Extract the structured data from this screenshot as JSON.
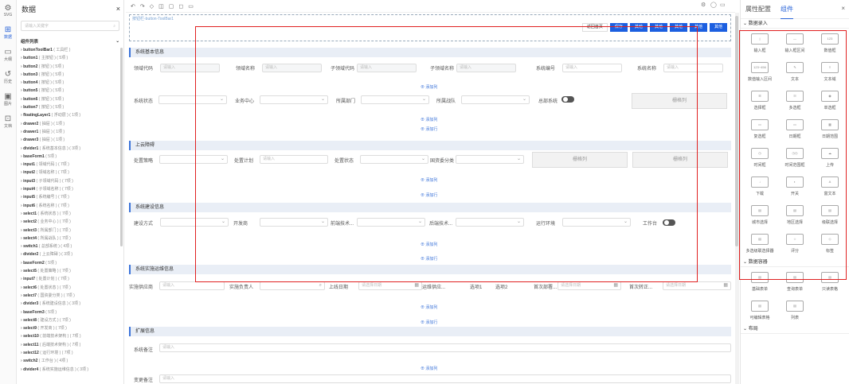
{
  "rail": [
    {
      "icon": "⚙",
      "label": "SVG"
    },
    {
      "icon": "⊞",
      "label": "数据"
    },
    {
      "icon": "▭",
      "label": "大纲"
    },
    {
      "icon": "↺",
      "label": "历史"
    },
    {
      "icon": "▣",
      "label": "图片"
    },
    {
      "icon": "⊡",
      "label": "文档"
    }
  ],
  "datapanel": {
    "title": "数据",
    "close": "×",
    "search_placeholder": "请输入关键字",
    "tree_title": "组件列表",
    "items": [
      {
        "n": "buttonToolBar1",
        "d": "( 工具栏 )"
      },
      {
        "n": "button1",
        "d": "( 主按钮 ) ( 5项 )"
      },
      {
        "n": "button2",
        "d": "( 按钮 ) ( 5项 )"
      },
      {
        "n": "button3",
        "d": "( 按钮 ) ( 5项 )"
      },
      {
        "n": "button4",
        "d": "( 按钮 ) ( 5项 )"
      },
      {
        "n": "button5",
        "d": "( 按钮 ) ( 5项 )"
      },
      {
        "n": "button6",
        "d": "( 按钮 ) ( 5项 )"
      },
      {
        "n": "button7",
        "d": "( 按钮 ) ( 5项 )"
      },
      {
        "n": "floatingLayer1",
        "d": "( 浮动层 ) ( 1项 )"
      },
      {
        "n": "drawer2",
        "d": "( 抽屉 ) ( 1项 )"
      },
      {
        "n": "drawer1",
        "d": "( 抽屉 ) ( 1项 )"
      },
      {
        "n": "drawer3",
        "d": "( 抽屉 ) ( 1项 )"
      },
      {
        "n": "divider1",
        "d": "( 系统基本信息 ) ( 3项 )"
      },
      {
        "n": "baseForm1",
        "d": "( 5项 )"
      },
      {
        "n": "input1",
        "d": "( 领域代码 ) ( 7项 )"
      },
      {
        "n": "input2",
        "d": "( 领域名称 ) ( 7项 )"
      },
      {
        "n": "input3",
        "d": "( 子领域代码 ) ( 7项 )"
      },
      {
        "n": "input4",
        "d": "( 子领域名称 ) ( 7项 )"
      },
      {
        "n": "input5",
        "d": "( 系统编号 ) ( 7项 )"
      },
      {
        "n": "input6",
        "d": "( 系统名称 ) ( 7项 )"
      },
      {
        "n": "select1",
        "d": "( 系统状态 ) ( 7项 )"
      },
      {
        "n": "select2",
        "d": "( 业务中心 ) ( 7项 )"
      },
      {
        "n": "select3",
        "d": "( 所属部门 ) ( 7项 )"
      },
      {
        "n": "select4",
        "d": "( 所属战队 ) ( 7项 )"
      },
      {
        "n": "switch1",
        "d": "( 总部系统 ) ( 4项 )"
      },
      {
        "n": "divider2",
        "d": "( 上云障碍 ) ( 3项 )"
      },
      {
        "n": "baseForm2",
        "d": "( 5项 )"
      },
      {
        "n": "select5",
        "d": "( 处置策略 ) ( 7项 )"
      },
      {
        "n": "input7",
        "d": "( 处置计划 ) ( 7项 )"
      },
      {
        "n": "select6",
        "d": "( 处置状态 ) ( 7项 )"
      },
      {
        "n": "select7",
        "d": "( 国资委分类 ) ( 7项 )"
      },
      {
        "n": "divider3",
        "d": "( 系统建设信息 ) ( 3项 )"
      },
      {
        "n": "baseForm3",
        "d": "( 5项 )"
      },
      {
        "n": "select8",
        "d": "( 建设方式 ) ( 7项 )"
      },
      {
        "n": "select9",
        "d": "( 开发商 ) ( 7项 )"
      },
      {
        "n": "select10",
        "d": "( 前端技术架构 ) ( 7项 )"
      },
      {
        "n": "select11",
        "d": "( 后端技术架构 ) ( 7项 )"
      },
      {
        "n": "select12",
        "d": "( 运行环境 ) ( 7项 )"
      },
      {
        "n": "switch2",
        "d": "( 工作台 ) ( 4项 )"
      },
      {
        "n": "divider4",
        "d": "( 系统实施运维信息 ) ( 3项 )"
      }
    ]
  },
  "toolbar": {
    "left": [
      "↶",
      "↷",
      "◇",
      "◫",
      "▢",
      "◻",
      "▭"
    ],
    "right": [
      "⚙",
      "◯",
      "▭"
    ]
  },
  "canvas": {
    "tbar_label": "按钮栏-button-ToolBar1",
    "buttons": {
      "default": "返回首页",
      "primary": [
        "保存",
        "其他",
        "其他",
        "其他",
        "其他",
        "其他"
      ]
    },
    "s1": "系统基本信息",
    "s2": "上云障碍",
    "s3": "系统建设信息",
    "s4": "系统实施运维信息",
    "s5": "扩展信息",
    "placeholder": "请输入",
    "placeholder_date": "请选择日期",
    "grid_label": "栅格列",
    "add_col": "添加列",
    "add_row": "添加行",
    "f1": [
      "领域代码",
      "领域名称",
      "子领域代码",
      "子领域名称",
      "系统编号",
      "系统名称"
    ],
    "f2": [
      "系统状态",
      "业务中心",
      "所属部门",
      "所属战队",
      "总部系统"
    ],
    "f3": [
      "处置策略",
      "处置计划",
      "处置状态",
      "国资委分类"
    ],
    "f4": [
      "建设方式",
      "开发商",
      "前端技术...",
      "后端技术...",
      "运行环境",
      "工作台"
    ],
    "f5": [
      "实施供应商",
      "实施负责人",
      "上线日期",
      "运维供应...",
      "选项1",
      "选项2",
      "首次部署...",
      "首次转正..."
    ],
    "f6": [
      "系统备注",
      "变更备注"
    ]
  },
  "props": {
    "tabs": [
      "属性配置",
      "组件"
    ],
    "close": "×",
    "g1": "数据录入",
    "g2": "数据容器",
    "g3": "布局",
    "items": [
      {
        "i": "|",
        "l": "输入框"
      },
      {
        "i": "—",
        "l": "输入框区间"
      },
      {
        "i": "123",
        "l": "数值框"
      },
      {
        "i": "123~456",
        "l": "数值输入区间"
      },
      {
        "i": "✎",
        "l": "文本"
      },
      {
        "i": "≡",
        "l": "文本域"
      },
      {
        "i": "☰",
        "l": "选择框"
      },
      {
        "i": "☷",
        "l": "多选框"
      },
      {
        "i": "◉",
        "l": "单选框"
      },
      {
        "i": "▭",
        "l": "复选框"
      },
      {
        "i": "▭",
        "l": "日期框"
      },
      {
        "i": "▦",
        "l": "日期范围"
      },
      {
        "i": "◷",
        "l": "时间框"
      },
      {
        "i": "◷◷",
        "l": "时间范围框"
      },
      {
        "i": "☁",
        "l": "上传"
      },
      {
        "i": "↓",
        "l": "下载"
      },
      {
        "i": "◐",
        "l": "开关"
      },
      {
        "i": "A",
        "l": "富文本"
      },
      {
        "i": "▤",
        "l": "城市选择"
      },
      {
        "i": "▤",
        "l": "地区选择"
      },
      {
        "i": "▤",
        "l": "级联选择"
      },
      {
        "i": "▤",
        "l": "多选级联选择器"
      },
      {
        "i": "☆",
        "l": "评分"
      },
      {
        "i": "◇",
        "l": "标签"
      }
    ],
    "items2": [
      {
        "i": "▤",
        "l": "基础表单"
      },
      {
        "i": "▤",
        "l": "查询表单"
      },
      {
        "i": "▤",
        "l": "只读表格"
      },
      {
        "i": "▤",
        "l": "可编辑表格"
      },
      {
        "i": "▤",
        "l": "列表"
      }
    ]
  },
  "colors": {
    "primary": "#1c5fe0",
    "selection": "#e02020"
  }
}
